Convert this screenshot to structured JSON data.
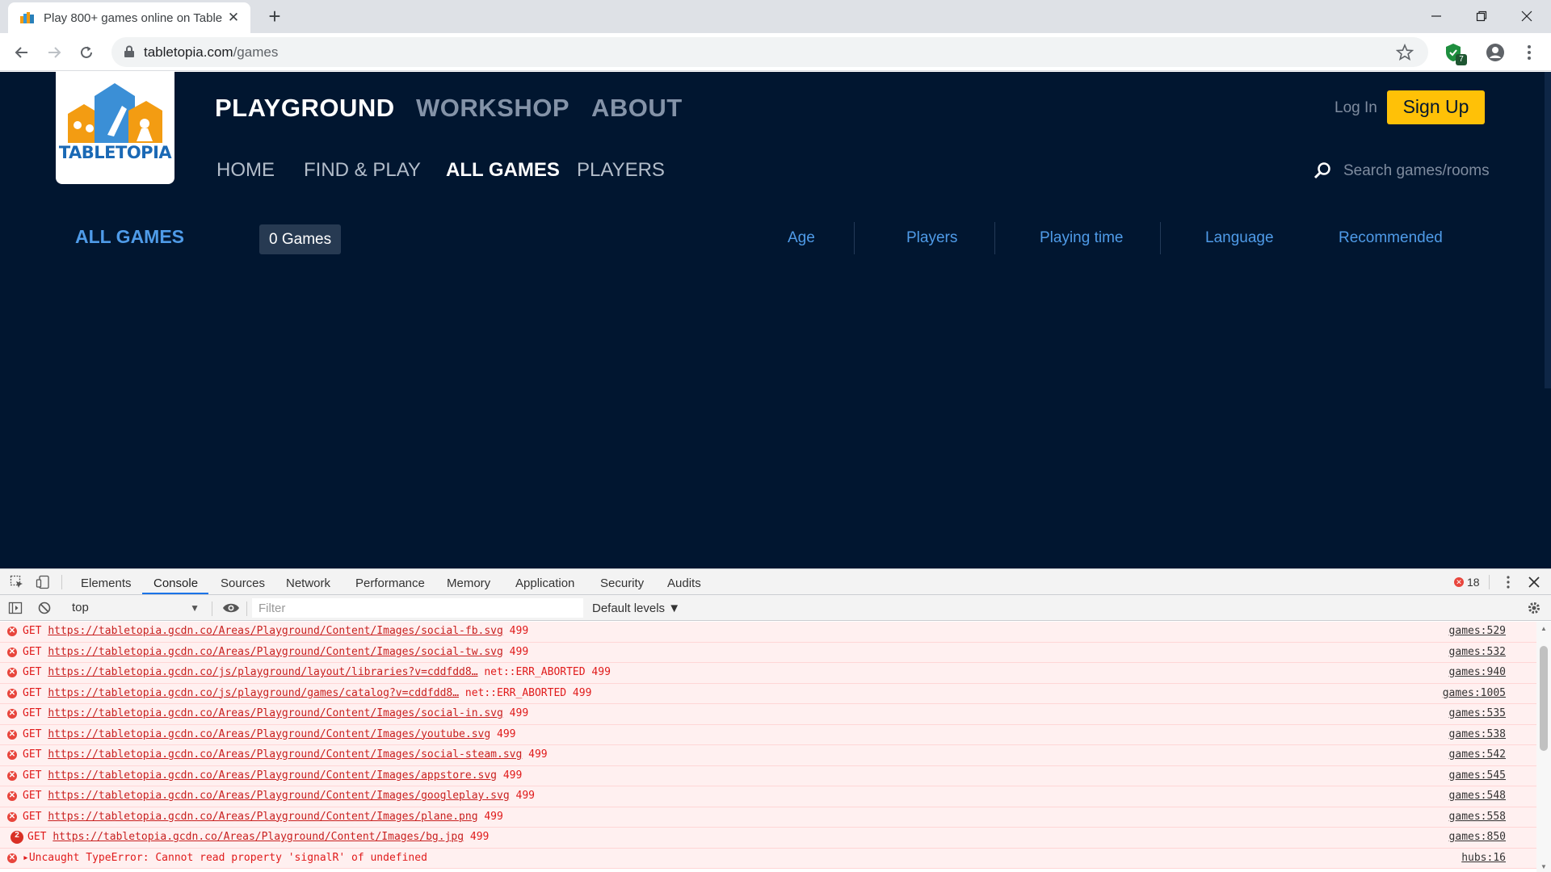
{
  "browser": {
    "tab_title": "Play 800+ games online on Table",
    "url_host": "tabletopia.com",
    "url_path": "/games",
    "extension_badge": "7"
  },
  "site": {
    "logo_text": "TABLETOPIA",
    "main_nav": [
      {
        "label": "PLAYGROUND",
        "active": true
      },
      {
        "label": "WORKSHOP",
        "active": false
      },
      {
        "label": "ABOUT",
        "active": false
      }
    ],
    "sub_nav": [
      {
        "label": "HOME",
        "active": false
      },
      {
        "label": "FIND & PLAY",
        "active": false
      },
      {
        "label": "ALL GAMES",
        "active": true
      },
      {
        "label": "PLAYERS",
        "active": false
      }
    ],
    "login_label": "Log In",
    "signup_label": "Sign Up",
    "search_placeholder": "Search games/rooms",
    "section_title": "ALL GAMES",
    "games_count": "0 Games",
    "filters": [
      "Age",
      "Players",
      "Playing time",
      "Language",
      "Recommended"
    ]
  },
  "devtools": {
    "tabs": [
      "Elements",
      "Console",
      "Sources",
      "Network",
      "Performance",
      "Memory",
      "Application",
      "Security",
      "Audits"
    ],
    "active_tab": "Console",
    "error_count": "18",
    "context": "top",
    "filter_placeholder": "Filter",
    "levels_label": "Default levels ▼",
    "messages": [
      {
        "method": "GET",
        "url": "https://tabletopia.gcdn.co/Areas/Playground/Content/Images/social-fb.svg",
        "suffix": "499",
        "source": "games:529"
      },
      {
        "method": "GET",
        "url": "https://tabletopia.gcdn.co/Areas/Playground/Content/Images/social-tw.svg",
        "suffix": "499",
        "source": "games:532"
      },
      {
        "method": "GET",
        "url": "https://tabletopia.gcdn.co/js/playground/layout/libraries?v=cddfdd8…",
        "suffix": "net::ERR_ABORTED 499",
        "source": "games:940"
      },
      {
        "method": "GET",
        "url": "https://tabletopia.gcdn.co/js/playground/games/catalog?v=cddfdd8…",
        "suffix": "net::ERR_ABORTED 499",
        "source": "games:1005"
      },
      {
        "method": "GET",
        "url": "https://tabletopia.gcdn.co/Areas/Playground/Content/Images/social-in.svg",
        "suffix": "499",
        "source": "games:535"
      },
      {
        "method": "GET",
        "url": "https://tabletopia.gcdn.co/Areas/Playground/Content/Images/youtube.svg",
        "suffix": "499",
        "source": "games:538"
      },
      {
        "method": "GET",
        "url": "https://tabletopia.gcdn.co/Areas/Playground/Content/Images/social-steam.svg",
        "suffix": "499",
        "source": "games:542"
      },
      {
        "method": "GET",
        "url": "https://tabletopia.gcdn.co/Areas/Playground/Content/Images/appstore.svg",
        "suffix": "499",
        "source": "games:545"
      },
      {
        "method": "GET",
        "url": "https://tabletopia.gcdn.co/Areas/Playground/Content/Images/googleplay.svg",
        "suffix": "499",
        "source": "games:548"
      },
      {
        "method": "GET",
        "url": "https://tabletopia.gcdn.co/Areas/Playground/Content/Images/plane.png",
        "suffix": "499",
        "source": "games:558"
      },
      {
        "method": "GET",
        "url": "https://tabletopia.gcdn.co/Areas/Playground/Content/Images/bg.jpg",
        "suffix": "499",
        "source": "games:850",
        "repeat": "2"
      },
      {
        "method": "▸Uncaught TypeError: Cannot read property 'signalR' of undefined",
        "url": "",
        "suffix": "",
        "source": "hubs:16"
      }
    ]
  },
  "colors": {
    "site_bg": "#011630",
    "accent_blue": "#4f9be8",
    "signup_yellow": "#ffc107",
    "error_red": "#e01b1b"
  }
}
